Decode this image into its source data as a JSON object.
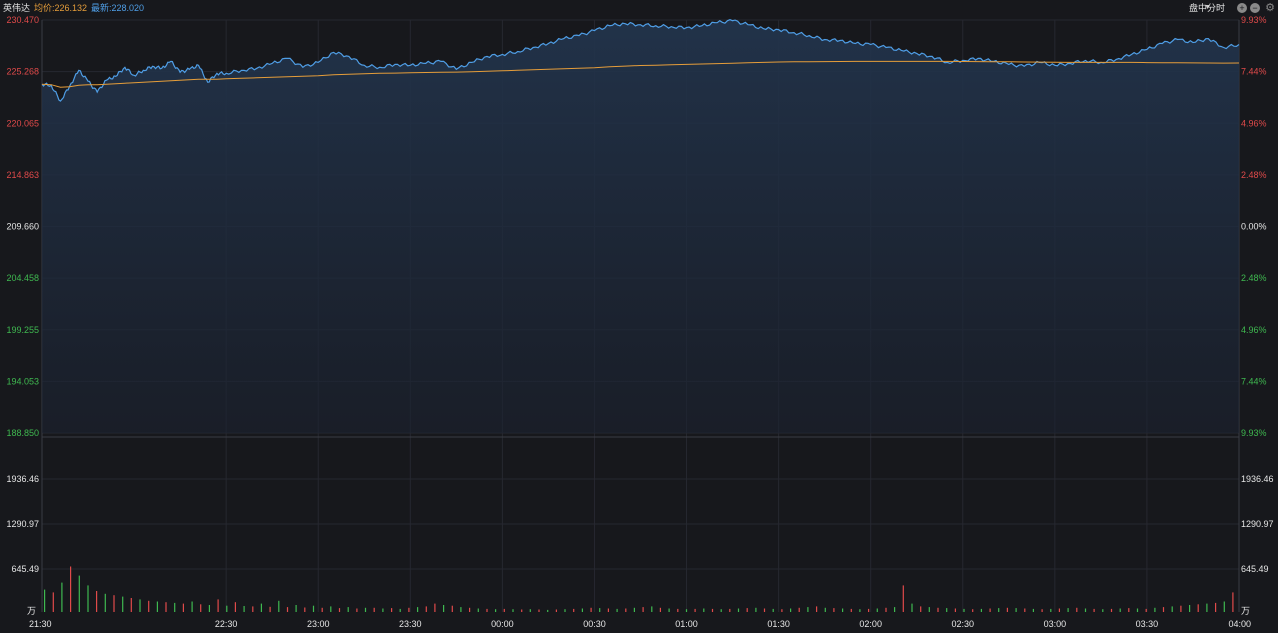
{
  "header": {
    "stock_name": "英伟达",
    "avg_label": "均价:226.132",
    "last_label": "最新:228.020",
    "mode_label": "盘中分时"
  },
  "colors": {
    "up": "#e04a4a",
    "down": "#3fb950",
    "neutral": "#e6e6e6",
    "price_line": "#4f9ee6",
    "avg_line": "#e59d3a",
    "background": "#17181c",
    "grid": "#262830"
  },
  "chart_data": {
    "type": "line",
    "title": "",
    "x_ticks": [
      "21:30",
      "22:30",
      "23:00",
      "23:30",
      "00:00",
      "00:30",
      "01:00",
      "01:30",
      "02:00",
      "02:30",
      "03:00",
      "03:30",
      "04:00"
    ],
    "price_axis": {
      "ylim": [
        188.85,
        230.47
      ],
      "left_ticks": [
        "230.470",
        "225.268",
        "220.065",
        "214.863",
        "209.660",
        "204.458",
        "199.255",
        "194.053",
        "188.850"
      ],
      "right_ticks": [
        "9.93%",
        "7.44%",
        "4.96%",
        "2.48%",
        "0.00%",
        "2.48%",
        "4.96%",
        "7.44%",
        "9.93%"
      ],
      "reference_price": 209.66
    },
    "volume_axis": {
      "unit": "万",
      "ticks": [
        "1936.46",
        "1290.97",
        "645.49"
      ],
      "ylim": [
        0,
        2200
      ]
    },
    "series": [
      {
        "x": [
          "21:30",
          "21:33",
          "21:36",
          "21:39",
          "21:42",
          "21:45",
          "21:48",
          "21:51",
          "21:54",
          "21:57",
          "22:00",
          "22:03",
          "22:06",
          "22:09",
          "22:12",
          "22:15",
          "22:18",
          "22:21",
          "22:24",
          "22:27",
          "22:30",
          "22:35",
          "22:40",
          "22:45",
          "22:50",
          "22:55",
          "23:00",
          "23:05",
          "23:10",
          "23:15",
          "23:20",
          "23:25",
          "23:30",
          "23:35",
          "23:40",
          "23:45",
          "23:50",
          "23:55",
          "00:00",
          "00:05",
          "00:10",
          "00:15",
          "00:20",
          "00:25",
          "00:30",
          "00:35",
          "00:40",
          "00:45",
          "00:50",
          "00:55",
          "01:00",
          "01:05",
          "01:10",
          "01:15",
          "01:20",
          "01:25",
          "01:30",
          "01:35",
          "01:40",
          "01:45",
          "01:50",
          "01:55",
          "02:00",
          "02:05",
          "02:10",
          "02:15",
          "02:20",
          "02:25",
          "02:30",
          "02:35",
          "02:40",
          "02:45",
          "02:50",
          "02:55",
          "03:00",
          "03:05",
          "03:10",
          "03:15",
          "03:20",
          "03:25",
          "03:30",
          "03:35",
          "03:40",
          "03:45",
          "03:50",
          "03:55",
          "04:00"
        ],
        "price": [
          224.0,
          223.9,
          222.3,
          223.8,
          225.4,
          224.3,
          223.2,
          224.4,
          224.8,
          225.7,
          224.9,
          225.4,
          225.8,
          225.6,
          226.3,
          225.2,
          225.5,
          225.9,
          224.2,
          225.1,
          225.1,
          225.4,
          225.6,
          226.1,
          226.6,
          225.7,
          226.2,
          227.2,
          226.8,
          225.9,
          225.7,
          226.0,
          225.9,
          226.1,
          226.3,
          225.5,
          226.2,
          226.8,
          227.0,
          227.3,
          227.7,
          228.1,
          228.6,
          228.9,
          229.4,
          229.9,
          230.1,
          230.0,
          229.9,
          229.8,
          229.7,
          229.9,
          230.2,
          230.4,
          230.0,
          229.6,
          229.5,
          229.2,
          228.9,
          228.5,
          228.4,
          228.1,
          228.0,
          227.7,
          227.4,
          227.1,
          226.8,
          226.2,
          226.4,
          226.6,
          226.3,
          226.0,
          225.8,
          226.2,
          225.9,
          226.1,
          226.4,
          226.2,
          226.5,
          227.0,
          227.5,
          228.1,
          228.5,
          228.2,
          228.6,
          227.7,
          228.0
        ],
        "avg": [
          224.0,
          223.95,
          223.7,
          223.75,
          223.9,
          223.95,
          223.95,
          224.0,
          224.05,
          224.1,
          224.15,
          224.2,
          224.25,
          224.3,
          224.35,
          224.4,
          224.45,
          224.5,
          224.5,
          224.5,
          224.55,
          224.6,
          224.65,
          224.7,
          224.75,
          224.8,
          224.85,
          224.95,
          225.0,
          225.05,
          225.1,
          225.12,
          225.15,
          225.18,
          225.2,
          225.22,
          225.25,
          225.3,
          225.35,
          225.4,
          225.45,
          225.5,
          225.55,
          225.6,
          225.65,
          225.75,
          225.82,
          225.88,
          225.92,
          225.96,
          226.0,
          226.04,
          226.08,
          226.12,
          226.16,
          226.2,
          226.24,
          226.26,
          226.27,
          226.28,
          226.29,
          226.3,
          226.3,
          226.3,
          226.3,
          226.3,
          226.3,
          226.3,
          226.29,
          226.28,
          226.27,
          226.26,
          226.24,
          226.23,
          226.22,
          226.2,
          226.2,
          226.2,
          226.2,
          226.2,
          226.18,
          226.17,
          226.16,
          226.15,
          226.14,
          226.13,
          226.132
        ]
      }
    ],
    "volume": [
      [
        320,
        "d"
      ],
      [
        280,
        "u"
      ],
      [
        420,
        "d"
      ],
      [
        650,
        "u"
      ],
      [
        520,
        "d"
      ],
      [
        380,
        "d"
      ],
      [
        300,
        "u"
      ],
      [
        260,
        "d"
      ],
      [
        240,
        "u"
      ],
      [
        220,
        "d"
      ],
      [
        200,
        "u"
      ],
      [
        180,
        "d"
      ],
      [
        160,
        "u"
      ],
      [
        150,
        "d"
      ],
      [
        140,
        "u"
      ],
      [
        130,
        "d"
      ],
      [
        120,
        "u"
      ],
      [
        150,
        "d"
      ],
      [
        110,
        "u"
      ],
      [
        100,
        "d"
      ],
      [
        180,
        "u"
      ],
      [
        90,
        "d"
      ],
      [
        140,
        "u"
      ],
      [
        85,
        "d"
      ],
      [
        80,
        "u"
      ],
      [
        120,
        "d"
      ],
      [
        75,
        "u"
      ],
      [
        160,
        "d"
      ],
      [
        70,
        "u"
      ],
      [
        100,
        "d"
      ],
      [
        65,
        "u"
      ],
      [
        90,
        "d"
      ],
      [
        60,
        "u"
      ],
      [
        80,
        "d"
      ],
      [
        55,
        "u"
      ],
      [
        70,
        "d"
      ],
      [
        50,
        "u"
      ],
      [
        60,
        "d"
      ],
      [
        60,
        "u"
      ],
      [
        50,
        "d"
      ],
      [
        55,
        "u"
      ],
      [
        45,
        "d"
      ],
      [
        60,
        "u"
      ],
      [
        70,
        "d"
      ],
      [
        80,
        "u"
      ],
      [
        120,
        "u"
      ],
      [
        100,
        "d"
      ],
      [
        90,
        "u"
      ],
      [
        70,
        "d"
      ],
      [
        60,
        "u"
      ],
      [
        50,
        "d"
      ],
      [
        45,
        "u"
      ],
      [
        40,
        "d"
      ],
      [
        45,
        "u"
      ],
      [
        40,
        "d"
      ],
      [
        35,
        "u"
      ],
      [
        40,
        "d"
      ],
      [
        35,
        "u"
      ],
      [
        30,
        "d"
      ],
      [
        35,
        "u"
      ],
      [
        40,
        "d"
      ],
      [
        45,
        "u"
      ],
      [
        50,
        "d"
      ],
      [
        60,
        "u"
      ],
      [
        55,
        "d"
      ],
      [
        50,
        "u"
      ],
      [
        45,
        "d"
      ],
      [
        50,
        "u"
      ],
      [
        60,
        "d"
      ],
      [
        70,
        "u"
      ],
      [
        80,
        "d"
      ],
      [
        60,
        "u"
      ],
      [
        50,
        "d"
      ],
      [
        45,
        "u"
      ],
      [
        40,
        "d"
      ],
      [
        45,
        "u"
      ],
      [
        50,
        "d"
      ],
      [
        45,
        "u"
      ],
      [
        40,
        "d"
      ],
      [
        45,
        "u"
      ],
      [
        50,
        "d"
      ],
      [
        55,
        "u"
      ],
      [
        60,
        "d"
      ],
      [
        50,
        "u"
      ],
      [
        45,
        "d"
      ],
      [
        40,
        "u"
      ],
      [
        50,
        "d"
      ],
      [
        60,
        "u"
      ],
      [
        70,
        "d"
      ],
      [
        80,
        "u"
      ],
      [
        60,
        "d"
      ],
      [
        55,
        "u"
      ],
      [
        50,
        "d"
      ],
      [
        45,
        "u"
      ],
      [
        40,
        "d"
      ],
      [
        45,
        "u"
      ],
      [
        50,
        "d"
      ],
      [
        60,
        "u"
      ],
      [
        70,
        "d"
      ],
      [
        380,
        "u"
      ],
      [
        120,
        "d"
      ],
      [
        80,
        "u"
      ],
      [
        70,
        "d"
      ],
      [
        60,
        "u"
      ],
      [
        55,
        "d"
      ],
      [
        50,
        "u"
      ],
      [
        45,
        "d"
      ],
      [
        40,
        "u"
      ],
      [
        45,
        "d"
      ],
      [
        50,
        "u"
      ],
      [
        55,
        "d"
      ],
      [
        60,
        "u"
      ],
      [
        55,
        "d"
      ],
      [
        50,
        "u"
      ],
      [
        45,
        "d"
      ],
      [
        40,
        "u"
      ],
      [
        45,
        "d"
      ],
      [
        50,
        "u"
      ],
      [
        55,
        "d"
      ],
      [
        60,
        "u"
      ],
      [
        50,
        "d"
      ],
      [
        45,
        "u"
      ],
      [
        40,
        "d"
      ],
      [
        45,
        "u"
      ],
      [
        50,
        "d"
      ],
      [
        55,
        "u"
      ],
      [
        50,
        "d"
      ],
      [
        45,
        "u"
      ],
      [
        60,
        "d"
      ],
      [
        70,
        "u"
      ],
      [
        80,
        "d"
      ],
      [
        90,
        "u"
      ],
      [
        100,
        "d"
      ],
      [
        110,
        "u"
      ],
      [
        120,
        "d"
      ],
      [
        130,
        "u"
      ],
      [
        150,
        "d"
      ],
      [
        280,
        "u"
      ]
    ]
  }
}
